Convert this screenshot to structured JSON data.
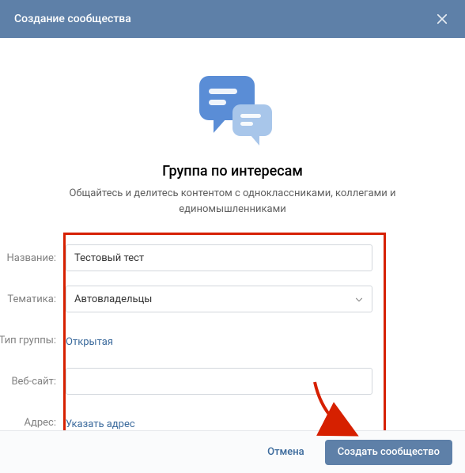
{
  "modal": {
    "title": "Создание сообщества"
  },
  "hero": {
    "heading": "Группа по интересам",
    "subheading": "Общайтесь и делитесь контентом с одноклассниками, коллегами и единомышленниками"
  },
  "form": {
    "name": {
      "label": "Название:",
      "value": "Тестовый тест"
    },
    "topic": {
      "label": "Тематика:",
      "value": "Автовладельцы"
    },
    "group_type": {
      "label": "Тип группы:",
      "value": "Открытая"
    },
    "website": {
      "label": "Веб-сайт:",
      "value": ""
    },
    "address": {
      "label": "Адрес:",
      "value": "Указать адрес"
    }
  },
  "footer": {
    "cancel": "Отмена",
    "submit": "Создать сообщество"
  }
}
